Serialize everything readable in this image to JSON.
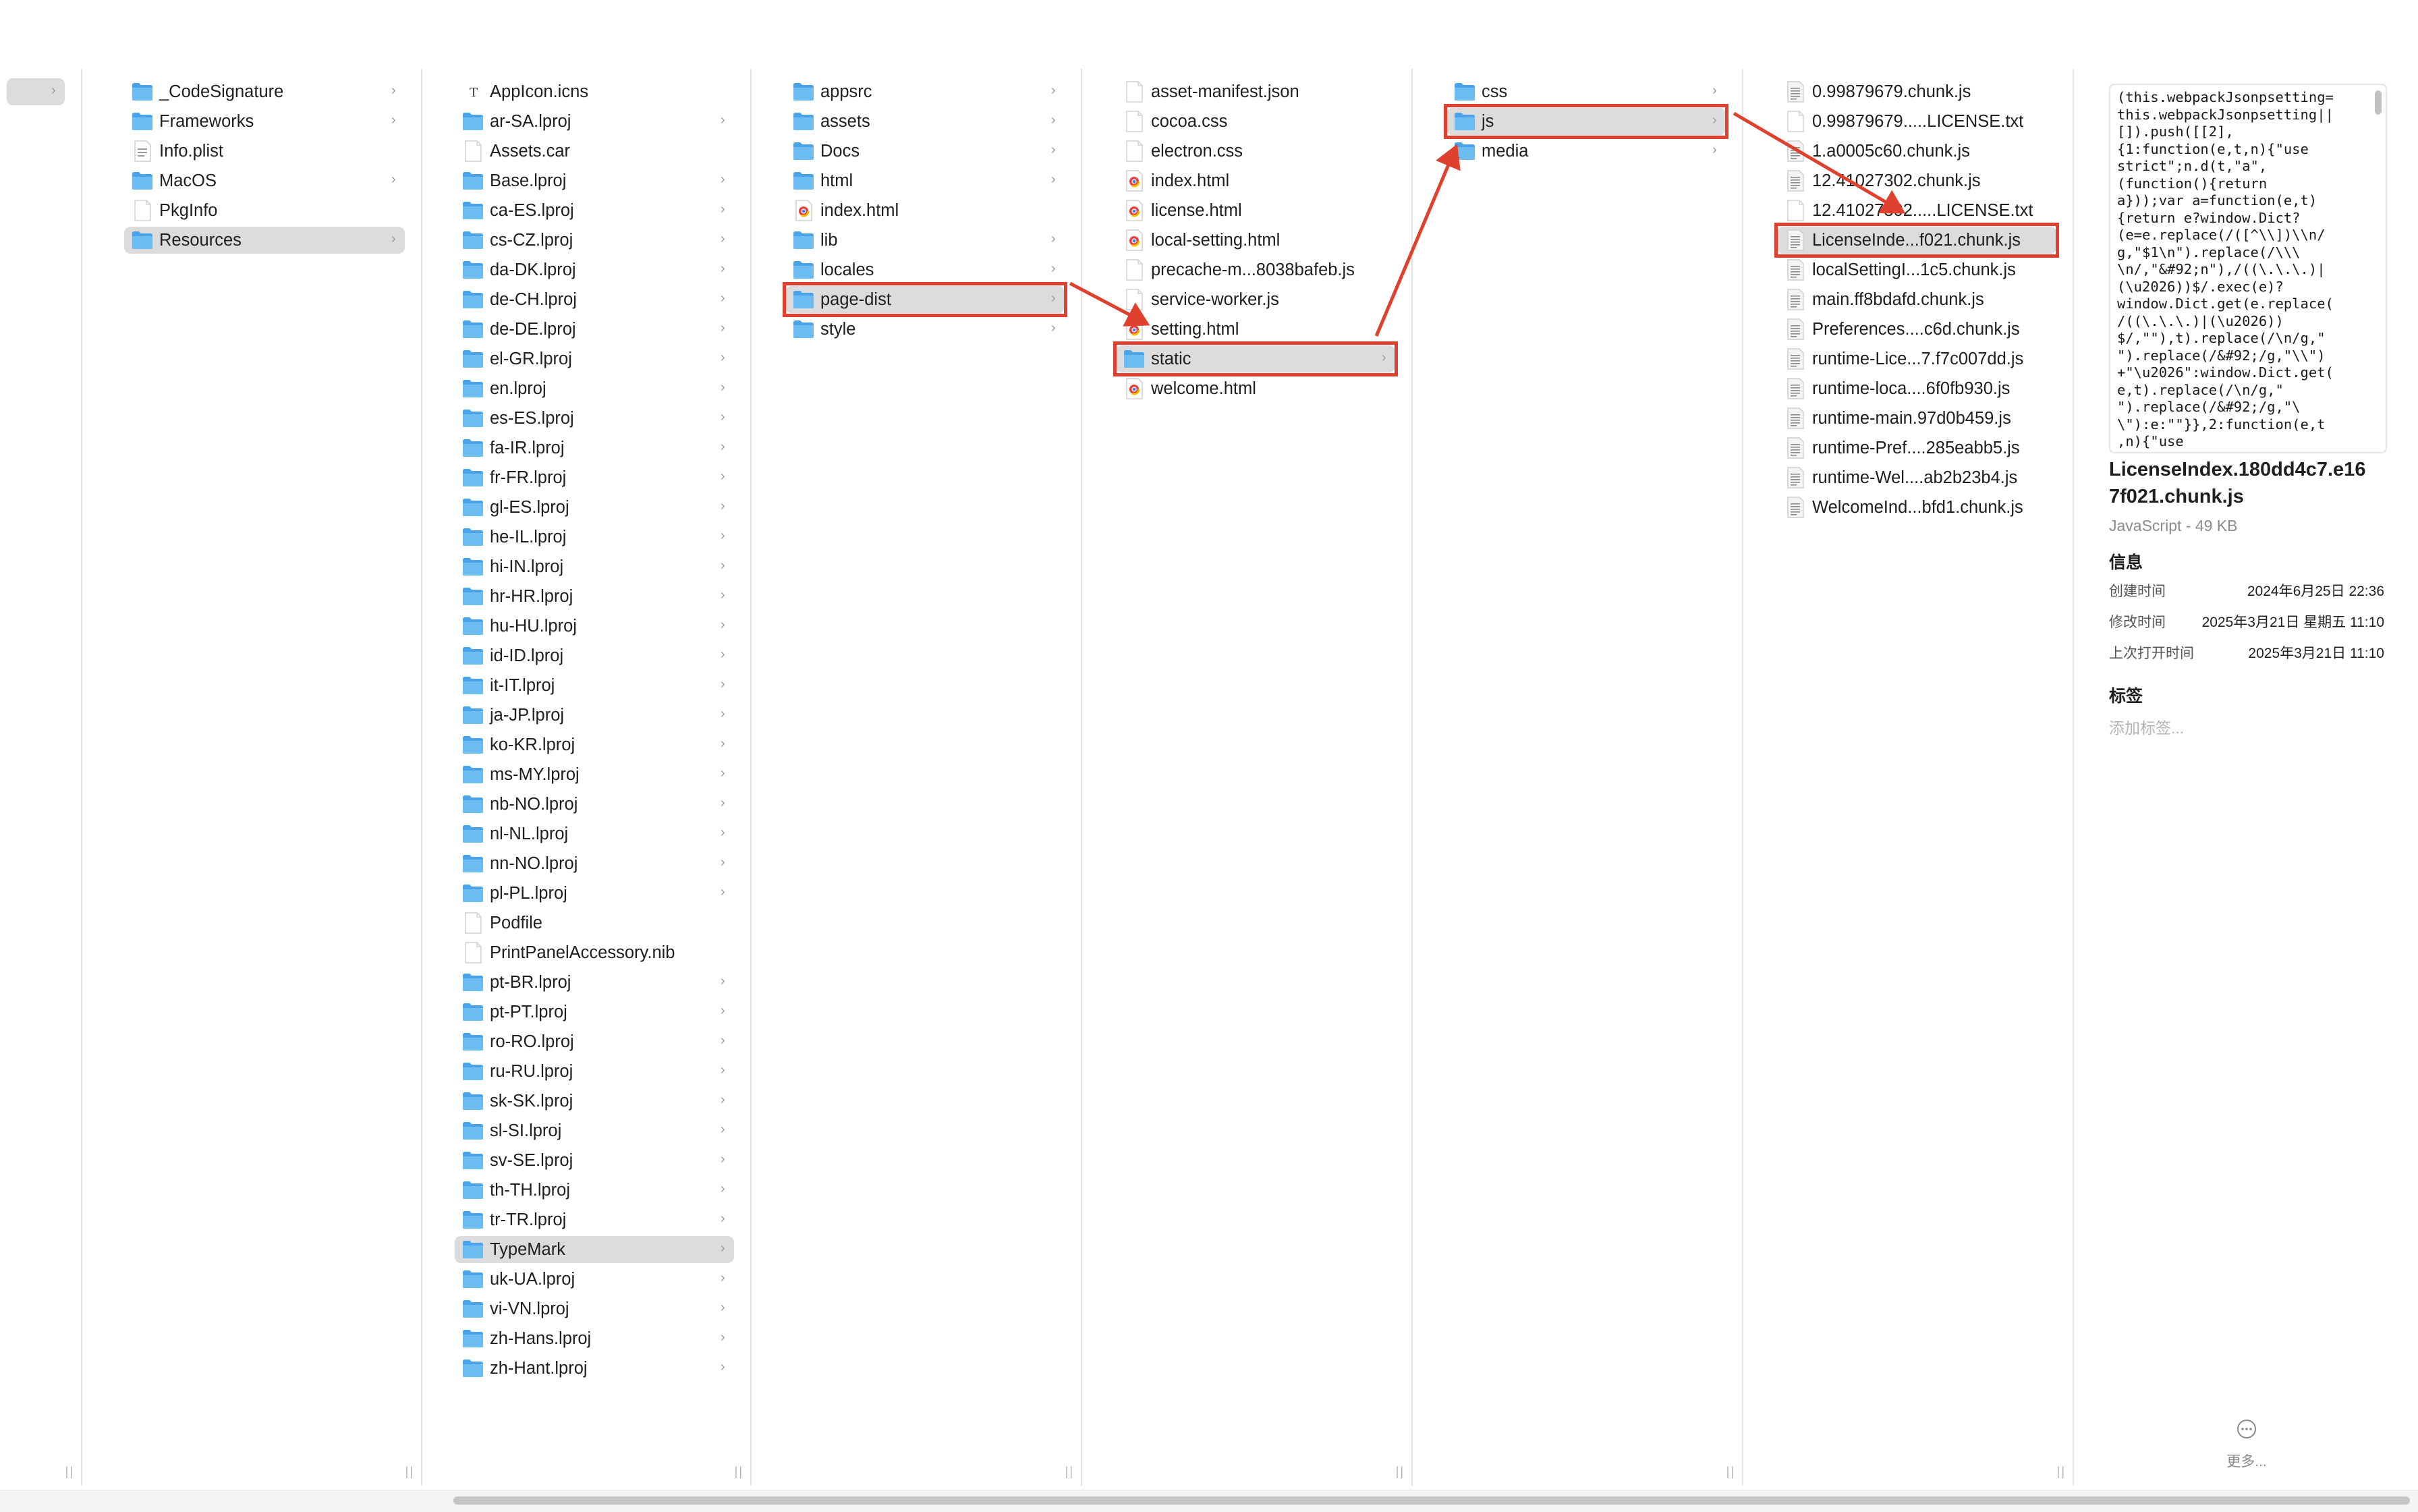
{
  "columns": [
    {
      "items": [
        {
          "name": "",
          "type": "folder",
          "chevron": true,
          "selected": true
        }
      ]
    },
    {
      "items": [
        {
          "name": "_CodeSignature",
          "type": "folder",
          "chevron": true
        },
        {
          "name": "Frameworks",
          "type": "folder",
          "chevron": true
        },
        {
          "name": "Info.plist",
          "type": "plist",
          "chevron": false
        },
        {
          "name": "MacOS",
          "type": "folder",
          "chevron": true
        },
        {
          "name": "PkgInfo",
          "type": "file",
          "chevron": false
        },
        {
          "name": "Resources",
          "type": "folder",
          "chevron": true,
          "selected": true
        }
      ]
    },
    {
      "items": [
        {
          "name": "AppIcon.icns",
          "type": "icns",
          "chevron": false
        },
        {
          "name": "ar-SA.lproj",
          "type": "folder",
          "chevron": true
        },
        {
          "name": "Assets.car",
          "type": "file",
          "chevron": false
        },
        {
          "name": "Base.lproj",
          "type": "folder",
          "chevron": true
        },
        {
          "name": "ca-ES.lproj",
          "type": "folder",
          "chevron": true
        },
        {
          "name": "cs-CZ.lproj",
          "type": "folder",
          "chevron": true
        },
        {
          "name": "da-DK.lproj",
          "type": "folder",
          "chevron": true
        },
        {
          "name": "de-CH.lproj",
          "type": "folder",
          "chevron": true
        },
        {
          "name": "de-DE.lproj",
          "type": "folder",
          "chevron": true
        },
        {
          "name": "el-GR.lproj",
          "type": "folder",
          "chevron": true
        },
        {
          "name": "en.lproj",
          "type": "folder",
          "chevron": true
        },
        {
          "name": "es-ES.lproj",
          "type": "folder",
          "chevron": true
        },
        {
          "name": "fa-IR.lproj",
          "type": "folder",
          "chevron": true
        },
        {
          "name": "fr-FR.lproj",
          "type": "folder",
          "chevron": true
        },
        {
          "name": "gl-ES.lproj",
          "type": "folder",
          "chevron": true
        },
        {
          "name": "he-IL.lproj",
          "type": "folder",
          "chevron": true
        },
        {
          "name": "hi-IN.lproj",
          "type": "folder",
          "chevron": true
        },
        {
          "name": "hr-HR.lproj",
          "type": "folder",
          "chevron": true
        },
        {
          "name": "hu-HU.lproj",
          "type": "folder",
          "chevron": true
        },
        {
          "name": "id-ID.lproj",
          "type": "folder",
          "chevron": true
        },
        {
          "name": "it-IT.lproj",
          "type": "folder",
          "chevron": true
        },
        {
          "name": "ja-JP.lproj",
          "type": "folder",
          "chevron": true
        },
        {
          "name": "ko-KR.lproj",
          "type": "folder",
          "chevron": true
        },
        {
          "name": "ms-MY.lproj",
          "type": "folder",
          "chevron": true
        },
        {
          "name": "nb-NO.lproj",
          "type": "folder",
          "chevron": true
        },
        {
          "name": "nl-NL.lproj",
          "type": "folder",
          "chevron": true
        },
        {
          "name": "nn-NO.lproj",
          "type": "folder",
          "chevron": true
        },
        {
          "name": "pl-PL.lproj",
          "type": "folder",
          "chevron": true
        },
        {
          "name": "Podfile",
          "type": "file",
          "chevron": false
        },
        {
          "name": "PrintPanelAccessory.nib",
          "type": "file",
          "chevron": false
        },
        {
          "name": "pt-BR.lproj",
          "type": "folder",
          "chevron": true
        },
        {
          "name": "pt-PT.lproj",
          "type": "folder",
          "chevron": true
        },
        {
          "name": "ro-RO.lproj",
          "type": "folder",
          "chevron": true
        },
        {
          "name": "ru-RU.lproj",
          "type": "folder",
          "chevron": true
        },
        {
          "name": "sk-SK.lproj",
          "type": "folder",
          "chevron": true
        },
        {
          "name": "sl-SI.lproj",
          "type": "folder",
          "chevron": true
        },
        {
          "name": "sv-SE.lproj",
          "type": "folder",
          "chevron": true
        },
        {
          "name": "th-TH.lproj",
          "type": "folder",
          "chevron": true
        },
        {
          "name": "tr-TR.lproj",
          "type": "folder",
          "chevron": true
        },
        {
          "name": "TypeMark",
          "type": "folder",
          "chevron": true,
          "selected": true
        },
        {
          "name": "uk-UA.lproj",
          "type": "folder",
          "chevron": true
        },
        {
          "name": "vi-VN.lproj",
          "type": "folder",
          "chevron": true
        },
        {
          "name": "zh-Hans.lproj",
          "type": "folder",
          "chevron": true
        },
        {
          "name": "zh-Hant.lproj",
          "type": "folder",
          "chevron": true
        }
      ]
    },
    {
      "items": [
        {
          "name": "appsrc",
          "type": "folder",
          "chevron": true
        },
        {
          "name": "assets",
          "type": "folder",
          "chevron": true
        },
        {
          "name": "Docs",
          "type": "folder",
          "chevron": true
        },
        {
          "name": "html",
          "type": "folder",
          "chevron": true
        },
        {
          "name": "index.html",
          "type": "html",
          "chevron": false
        },
        {
          "name": "lib",
          "type": "folder",
          "chevron": true
        },
        {
          "name": "locales",
          "type": "folder",
          "chevron": true
        },
        {
          "name": "page-dist",
          "type": "folder",
          "chevron": true,
          "selected": true,
          "highlight": true
        },
        {
          "name": "style",
          "type": "folder",
          "chevron": true
        }
      ]
    },
    {
      "items": [
        {
          "name": "asset-manifest.json",
          "type": "file",
          "chevron": false
        },
        {
          "name": "cocoa.css",
          "type": "file",
          "chevron": false
        },
        {
          "name": "electron.css",
          "type": "file",
          "chevron": false
        },
        {
          "name": "index.html",
          "type": "html",
          "chevron": false
        },
        {
          "name": "license.html",
          "type": "html",
          "chevron": false
        },
        {
          "name": "local-setting.html",
          "type": "html",
          "chevron": false
        },
        {
          "name": "precache-m...8038bafeb.js",
          "type": "file",
          "chevron": false
        },
        {
          "name": "service-worker.js",
          "type": "file",
          "chevron": false
        },
        {
          "name": "setting.html",
          "type": "html",
          "chevron": false
        },
        {
          "name": "static",
          "type": "folder",
          "chevron": true,
          "selected": true,
          "highlight": true
        },
        {
          "name": "welcome.html",
          "type": "html",
          "chevron": false
        }
      ]
    },
    {
      "items": [
        {
          "name": "css",
          "type": "folder",
          "chevron": true
        },
        {
          "name": "js",
          "type": "folder",
          "chevron": true,
          "selected": true,
          "highlight": true
        },
        {
          "name": "media",
          "type": "folder",
          "chevron": true
        }
      ]
    },
    {
      "items": [
        {
          "name": "0.99879679.chunk.js",
          "type": "js",
          "chevron": false
        },
        {
          "name": "0.99879679.....LICENSE.txt",
          "type": "file",
          "chevron": false
        },
        {
          "name": "1.a0005c60.chunk.js",
          "type": "js",
          "chevron": false
        },
        {
          "name": "12.41027302.chunk.js",
          "type": "js",
          "chevron": false
        },
        {
          "name": "12.41027302.....LICENSE.txt",
          "type": "file",
          "chevron": false
        },
        {
          "name": "LicenseInde...f021.chunk.js",
          "type": "js",
          "chevron": false,
          "selected": true,
          "highlight": true
        },
        {
          "name": "localSettingI...1c5.chunk.js",
          "type": "js",
          "chevron": false
        },
        {
          "name": "main.ff8bdafd.chunk.js",
          "type": "js",
          "chevron": false
        },
        {
          "name": "Preferences....c6d.chunk.js",
          "type": "js",
          "chevron": false
        },
        {
          "name": "runtime-Lice...7.f7c007dd.js",
          "type": "js",
          "chevron": false
        },
        {
          "name": "runtime-loca....6f0fb930.js",
          "type": "js",
          "chevron": false
        },
        {
          "name": "runtime-main.97d0b459.js",
          "type": "js",
          "chevron": false
        },
        {
          "name": "runtime-Pref....285eabb5.js",
          "type": "js",
          "chevron": false
        },
        {
          "name": "runtime-Wel....ab2b23b4.js",
          "type": "js",
          "chevron": false
        },
        {
          "name": "WelcomeInd...bfd1.chunk.js",
          "type": "js",
          "chevron": false
        }
      ]
    }
  ],
  "preview": {
    "code_lines": [
      "(this.webpackJsonpsetting=",
      "this.webpackJsonpsetting||",
      "[]).push([[2],",
      "{1:function(e,t,n){\"use",
      "strict\";n.d(t,\"a\",",
      "(function(){return",
      "a}));var a=function(e,t)",
      "{return e?window.Dict?",
      "(e=e.replace(/([^\\\\])\\\\n/",
      "g,\"$1\\n\").replace(/\\\\\\",
      "\\n/,\"&#92;n\"),/((\\.\\.\\.)|",
      "(\\u2026))$/.exec(e)?",
      "window.Dict.get(e.replace(",
      "/((\\.\\.\\.)|(\\u2026))",
      "$/,\"\"),t).replace(/\\n/g,\"",
      "\").replace(/&#92;/g,\"\\\\\")",
      "+\"\\u2026\":window.Dict.get(",
      "e,t).replace(/\\n/g,\"",
      "\").replace(/&#92;/g,\"\\",
      "\\\"):e:\"\"}},2:function(e,t",
      ",n){\"use"
    ],
    "filename_line1": "LicenseIndex.180dd4c7.e16",
    "filename_line2": "7f021.chunk.js",
    "kind_size": "JavaScript - 49 KB",
    "info_header": "信息",
    "info": [
      {
        "label": "创建时间",
        "value": "2024年6月25日 22:36"
      },
      {
        "label": "修改时间",
        "value": "2025年3月21日 星期五 11:10"
      },
      {
        "label": "上次打开时间",
        "value": "2025年3月21日 11:10"
      }
    ],
    "tags_header": "标签",
    "tags_placeholder": "添加标签...",
    "more_label": "更多..."
  },
  "colors": {
    "annotation": "#e0412f",
    "folder": "#5ab0ef",
    "selection": "#dcdcdc"
  }
}
